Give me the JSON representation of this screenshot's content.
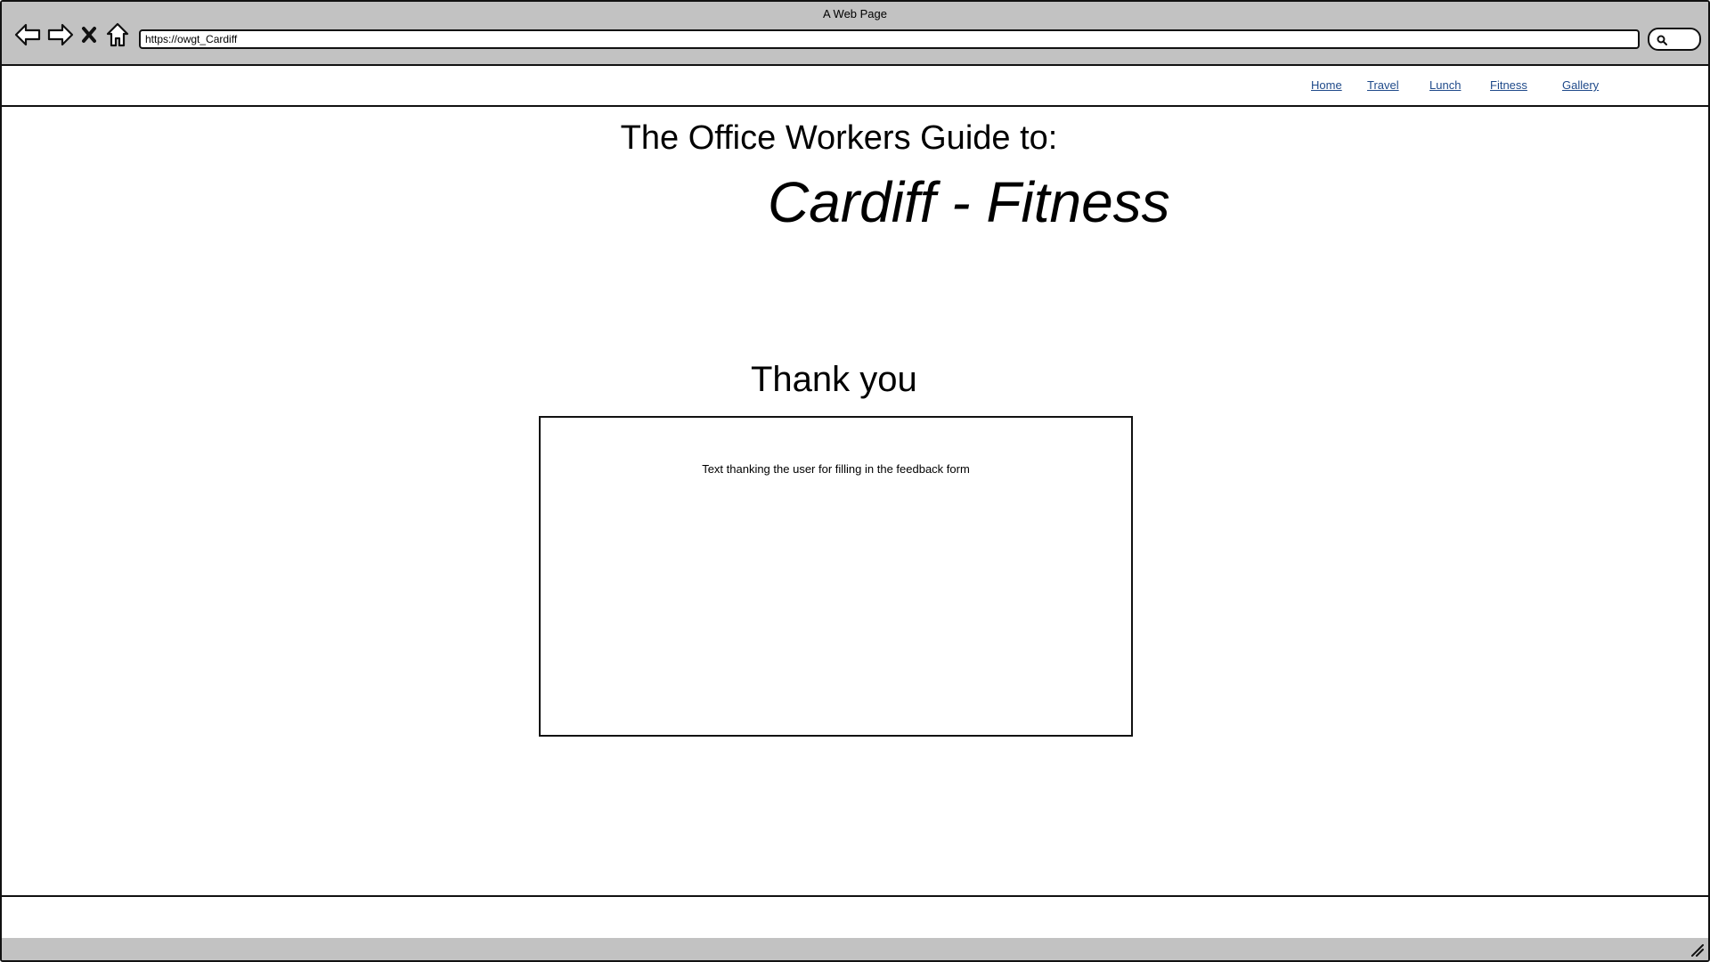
{
  "window": {
    "title": "A Web Page",
    "url": "https://owgt_Cardiff"
  },
  "nav": {
    "links": [
      "Home",
      "Travel",
      "Lunch",
      "Fitness",
      "Gallery"
    ]
  },
  "content": {
    "heading": "The Office Workers Guide to:",
    "subheading": "Cardiff - Fitness",
    "thank_you_title": "Thank you",
    "thank_you_text": "Text thanking the user for filling in the feedback form"
  },
  "icons": {
    "back": "back-arrow-icon",
    "forward": "forward-arrow-icon",
    "stop": "close-icon",
    "home": "home-icon",
    "search": "search-icon",
    "resize": "resize-grip-icon"
  },
  "colors": {
    "chrome": "#c2c2c2",
    "link": "#1f4a8a",
    "border": "#111111"
  }
}
